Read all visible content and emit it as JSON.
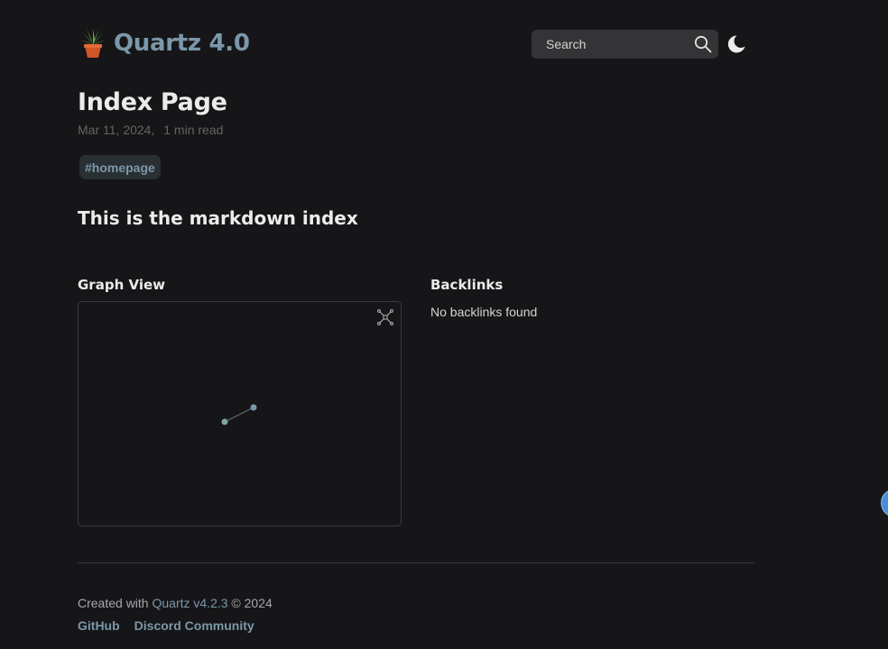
{
  "header": {
    "site_title": "Quartz 4.0",
    "logo_icon": "potted-plant-icon",
    "search_label": "Search",
    "search_icon": "search-icon",
    "darkmode_icon": "moon-icon"
  },
  "article": {
    "title": "Index Page",
    "date": "Mar 11, 2024,",
    "read_time": "1 min read",
    "tags": [
      "#homepage"
    ],
    "heading": "This is the markdown index"
  },
  "graph": {
    "heading": "Graph View",
    "global_icon": "global-graph-icon",
    "node_color": "#7b97aa",
    "edge_color": "#5a6b75"
  },
  "backlinks": {
    "heading": "Backlinks",
    "empty_text": "No backlinks found"
  },
  "footer": {
    "created_with": "Created with",
    "quartz_link": "Quartz v4.2.3",
    "copyright": "© 2024",
    "links": [
      "GitHub",
      "Discord Community"
    ]
  },
  "colors": {
    "background": "#161618",
    "accent": "#7b97aa",
    "text": "#ebebec"
  }
}
